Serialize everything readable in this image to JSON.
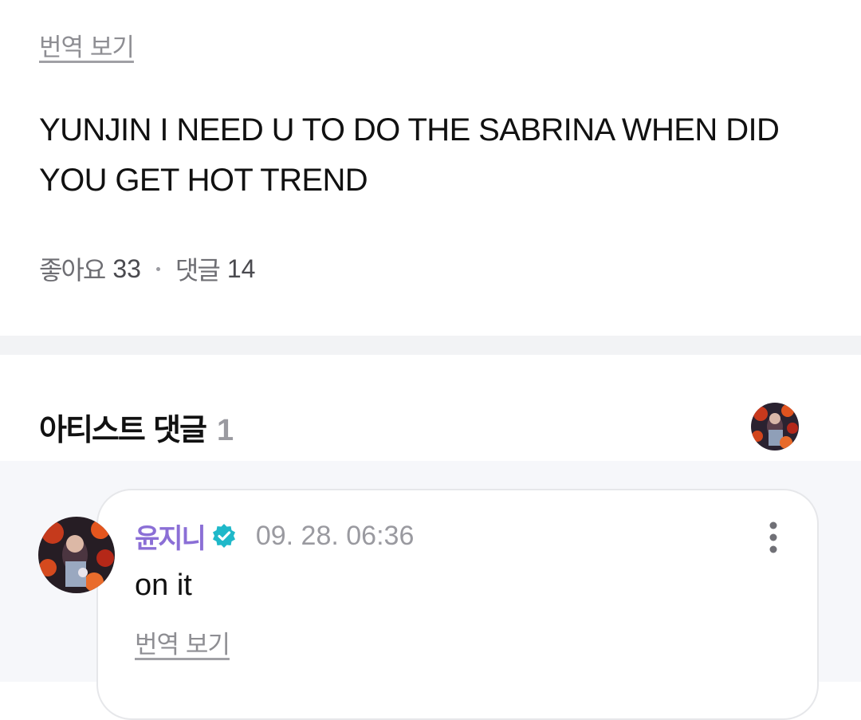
{
  "post": {
    "translate_label": "번역 보기",
    "body": "YUNJIN I NEED U TO DO THE SABRINA WHEN DID YOU GET HOT TREND",
    "likes_label": "좋아요",
    "likes_count": "33",
    "comments_label": "댓글",
    "comments_count": "14"
  },
  "artist_comments": {
    "title": "아티스트 댓글",
    "count": "1",
    "header_avatar_icon": "artist-profile-avatar"
  },
  "comment": {
    "author": "윤지니",
    "verified_icon": "verified-badge-icon",
    "verified_color": "#1fb8c9",
    "author_color": "#8b6fd6",
    "timestamp": "09. 28. 06:36",
    "text": "on it",
    "translate_label": "번역 보기",
    "more_icon": "more-vertical-icon"
  }
}
